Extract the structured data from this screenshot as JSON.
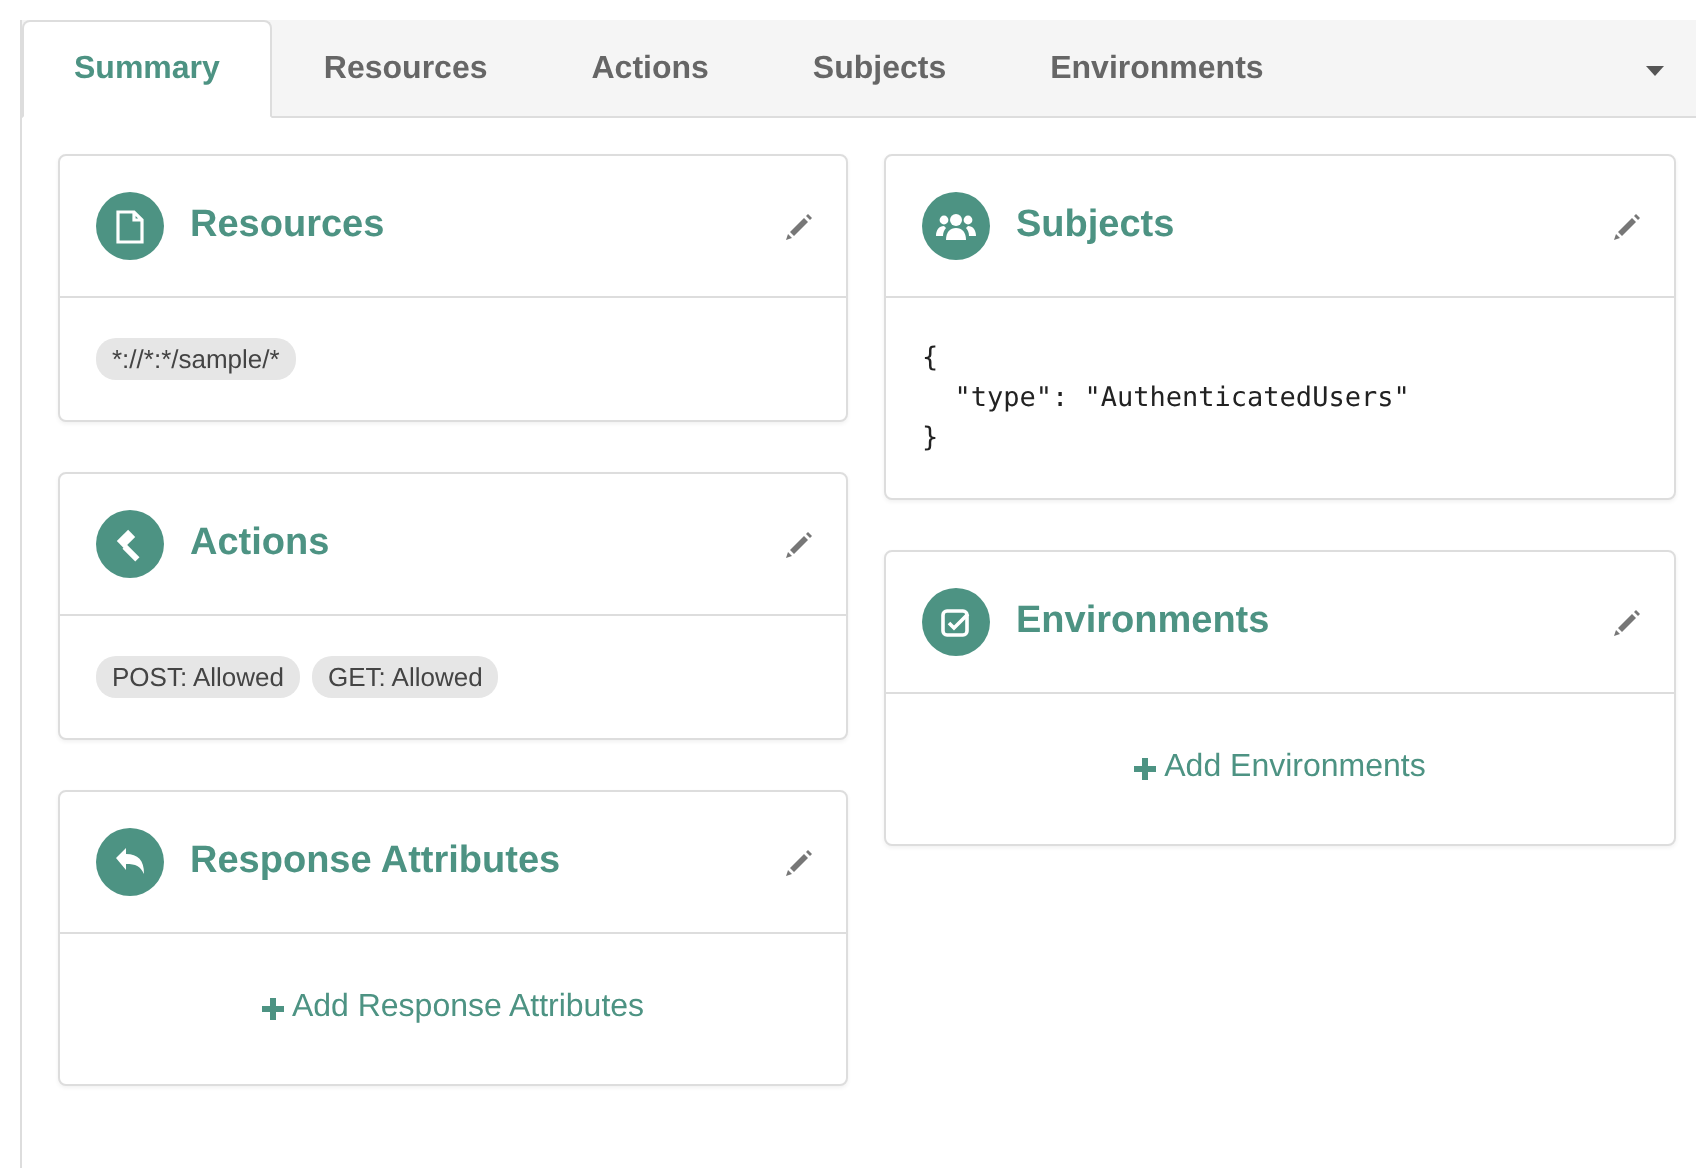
{
  "tabs": [
    {
      "label": "Summary",
      "selected": true
    },
    {
      "label": "Resources",
      "selected": false
    },
    {
      "label": "Actions",
      "selected": false
    },
    {
      "label": "Subjects",
      "selected": false
    },
    {
      "label": "Environments",
      "selected": false
    }
  ],
  "columns": [
    [
      {
        "title": "Resources",
        "kind": "tags",
        "tags": [
          "*://*:*/sample/*"
        ]
      },
      {
        "title": "Actions",
        "kind": "tags",
        "tags": [
          "POST: Allowed",
          "GET: Allowed"
        ]
      },
      {
        "title": "Response Attributes",
        "kind": "add",
        "add_label": "Add Response Attributes"
      }
    ],
    [
      {
        "title": "Subjects",
        "kind": "code",
        "code_lines": [
          "{",
          "  \"type\": \"AuthenticatedUsers\"",
          "}"
        ]
      },
      {
        "title": "Environments",
        "kind": "add",
        "add_label": "Add Environments"
      }
    ]
  ]
}
